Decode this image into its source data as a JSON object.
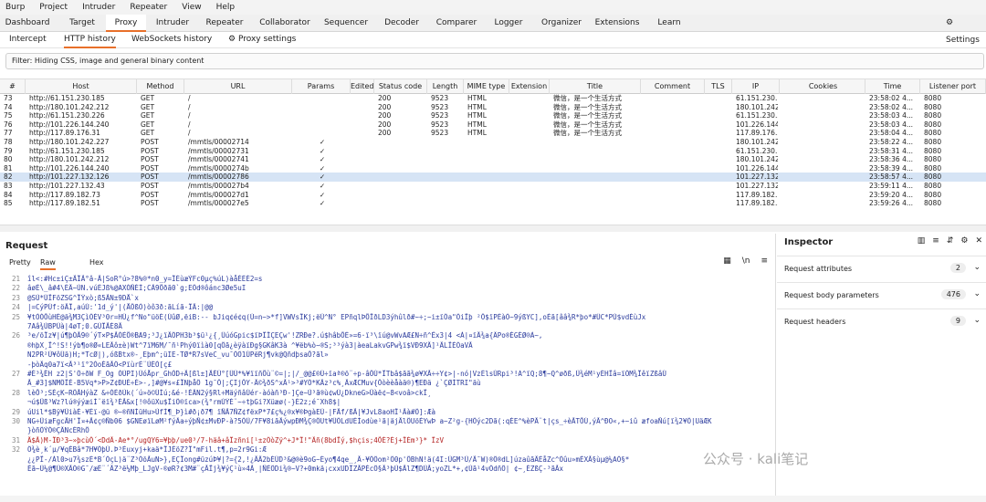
{
  "menubar": {
    "items": [
      "Burp",
      "Project",
      "Intruder",
      "Repeater",
      "View",
      "Help"
    ]
  },
  "main_tabs": {
    "items": [
      {
        "label": "Dashboard"
      },
      {
        "label": "Target"
      },
      {
        "label": "Proxy"
      },
      {
        "label": "Intruder"
      },
      {
        "label": "Repeater"
      },
      {
        "label": "Collaborator"
      },
      {
        "label": "Sequencer"
      },
      {
        "label": "Decoder"
      },
      {
        "label": "Comparer"
      },
      {
        "label": "Logger"
      },
      {
        "label": "Organizer"
      },
      {
        "label": "Extensions"
      },
      {
        "label": "Learn"
      }
    ],
    "active": "Proxy",
    "settings_label": "Settings",
    "settings_icon": "gear-icon"
  },
  "proxy_tabs": {
    "items": [
      {
        "label": "Intercept"
      },
      {
        "label": "HTTP history"
      },
      {
        "label": "WebSockets history"
      }
    ],
    "active": "HTTP history",
    "settings_label": "Proxy settings"
  },
  "filter": {
    "text": "Filter: Hiding CSS, image and general binary content"
  },
  "history_table": {
    "columns": [
      "#",
      "Host",
      "Method",
      "URL",
      "Params",
      "Edited",
      "Status code",
      "Length",
      "MIME type",
      "Extension",
      "Title",
      "Comment",
      "TLS",
      "IP",
      "Cookies",
      "Time",
      "Listener port"
    ],
    "rows": [
      {
        "id": "73",
        "host": "http://61.151.230.185",
        "method": "GET",
        "url": "/",
        "params": "",
        "status": "200",
        "length": "9523",
        "mime": "HTML",
        "title": "微信，是一个生活方式",
        "ip": "61.151.230.185",
        "time": "23:58:02 4...",
        "port": "8080"
      },
      {
        "id": "74",
        "host": "http://180.101.242.212",
        "method": "GET",
        "url": "/",
        "params": "",
        "status": "200",
        "length": "9523",
        "mime": "HTML",
        "title": "微信，是一个生活方式",
        "ip": "180.101.242.212",
        "time": "23:58:02 4...",
        "port": "8080"
      },
      {
        "id": "75",
        "host": "http://61.151.230.226",
        "method": "GET",
        "url": "/",
        "params": "",
        "status": "200",
        "length": "9523",
        "mime": "HTML",
        "title": "微信，是一个生活方式",
        "ip": "61.151.230.226",
        "time": "23:58:03 4...",
        "port": "8080"
      },
      {
        "id": "76",
        "host": "http://101.226.144.240",
        "method": "GET",
        "url": "/",
        "params": "",
        "status": "200",
        "length": "9523",
        "mime": "HTML",
        "title": "微信，是一个生活方式",
        "ip": "101.226.144.240",
        "time": "23:58:03 4...",
        "port": "8080"
      },
      {
        "id": "77",
        "host": "http://117.89.176.31",
        "method": "GET",
        "url": "/",
        "params": "",
        "status": "200",
        "length": "9523",
        "mime": "HTML",
        "title": "微信，是一个生活方式",
        "ip": "117.89.176.31",
        "time": "23:58:04 4...",
        "port": "8080"
      },
      {
        "id": "78",
        "host": "http://180.101.242.227",
        "method": "POST",
        "url": "/mmtls/00002714",
        "params": "✓",
        "status": "",
        "length": "",
        "mime": "",
        "title": "",
        "ip": "180.101.242.227",
        "time": "23:58:22 4...",
        "port": "8080"
      },
      {
        "id": "79",
        "host": "http://61.151.230.185",
        "method": "POST",
        "url": "/mmtls/00002731",
        "params": "✓",
        "status": "",
        "length": "",
        "mime": "",
        "title": "",
        "ip": "61.151.230.185",
        "time": "23:58:31 4...",
        "port": "8080"
      },
      {
        "id": "80",
        "host": "http://180.101.242.212",
        "method": "POST",
        "url": "/mmtls/00002741",
        "params": "✓",
        "status": "",
        "length": "",
        "mime": "",
        "title": "",
        "ip": "180.101.242.212",
        "time": "23:58:36 4...",
        "port": "8080"
      },
      {
        "id": "81",
        "host": "http://101.226.144.240",
        "method": "POST",
        "url": "/mmtls/0000274b",
        "params": "✓",
        "status": "",
        "length": "",
        "mime": "",
        "title": "",
        "ip": "101.226.144.240",
        "time": "23:58:39 4...",
        "port": "8080"
      },
      {
        "id": "82",
        "host": "http://101.227.132.126",
        "method": "POST",
        "url": "/mmtls/00002786",
        "params": "✓",
        "status": "",
        "length": "",
        "mime": "",
        "title": "",
        "ip": "101.227.132.126",
        "time": "23:58:57 4...",
        "port": "8080",
        "selected": true
      },
      {
        "id": "83",
        "host": "http://101.227.132.43",
        "method": "POST",
        "url": "/mmtls/000027b4",
        "params": "✓",
        "status": "",
        "length": "",
        "mime": "",
        "title": "",
        "ip": "101.227.132.43",
        "time": "23:59:11 4...",
        "port": "8080"
      },
      {
        "id": "84",
        "host": "http://117.89.182.73",
        "method": "POST",
        "url": "/mmtls/000027d1",
        "params": "✓",
        "status": "",
        "length": "",
        "mime": "",
        "title": "",
        "ip": "117.89.182.73",
        "time": "23:59:20 4...",
        "port": "8080"
      },
      {
        "id": "85",
        "host": "http://117.89.182.51",
        "method": "POST",
        "url": "/mmtls/000027e5",
        "params": "✓",
        "status": "",
        "length": "",
        "mime": "",
        "title": "",
        "ip": "117.89.182.51",
        "time": "23:59:26 4...",
        "port": "8080"
      }
    ]
  },
  "request": {
    "title": "Request",
    "tabs": [
      "Pretty",
      "Raw",
      "Hex"
    ],
    "active_tab": "Raw",
    "lines": [
      {
        "n": "21",
        "t": "îl<:#Hc±iÇ±ÃÏÃ°â-Ã|SoR°ú>?8%®*n0_y=ÏÈùæÝFc0µç%úL)àåÉÉÉ2=s"
      },
      {
        "n": "22",
        "t": "âøÉ\\_â#4\\ÉÄ~ÚN.vúÉJß%@AXÒÑÉÍ;CÂ9Õðã0`g;EÖd®ôánc3Øe5uI"
      },
      {
        "n": "23",
        "t": "@SÙ*ÜÏFöZSG^ÏÝxò;ß5ÃN±9DÅ`x"
      },
      {
        "n": "24",
        "t": "|=CýPÚf:öÄÏ,aúÙ:'1d_ý'|(ÅÔßÒ)òô3ð:ãLíã-ÏÃ:|@@"
      },
      {
        "n": "25",
        "t": "¥tÒÒÕùHÉ@ä¾M3ÇìÖÉV³0r=HÜ¿f^No\"üöÉ(ÙûØ,ëiB:-- bJiq¢é¢q(Ú=n~>*f]VWVsÏKj;ëÜ^N° EPñqlÞÕÏðLD3ýhûlð#~÷;~i±ïÖa\"ÖiÏþ ²Ô$ïPÉàÒ~9ýßYC],oÉã[ââ¾R*þo*#ÜC*PÚ$vdÈùJx"
      },
      {
        "n": "",
        "t": "7Aâ¾ÙBPÜà|4øT;0.GÙÏÃÉ8Ã"
      },
      {
        "n": "26",
        "t": "³e/õÏz¥|ú¶þÓÃ9®´ýT×P$ÃÒÈÕ®BA9;³J¿ïÃÖPH3b³$ü¹¿{¸ÜúóGpic$ïÞÏÎÇEÇw'!ZRÐe?.ú$hâbÕÈ»=6·ï³\\ïú@vWvAÆ£N÷ñ^Êx3|4 <Á|¤ïÄ¾a{ÂPo®ÉGÉØ®À~,"
      },
      {
        "n": "",
        "t": "®hþX¸Ï^!S!!ýb¶o®Ø«LEÃô±è)Wt^7ïM6M/¯ñ¹Phý0ïìà0[qÔã¿èÿàïÐg§GKâK3à ^¥ëb%ò~®S;³³ýà3|àeaLakvGPw¾ï$VÐ9XÄ]¹ÄLÏÉÒaVÃ"
      },
      {
        "n": "",
        "t": "N2PR²Ü¥ôÜä)H;*TcØ|),óßBtx®-¸Eþm^;üIE-TØ*R7sVeC_vu¯ÖÖ1ÚPëRj¶vk@QñdþsaÕ?ãl»"
      },
      {
        "n": "",
        "t": "-þòÃq0a7ï<Ã³¹ï°2ÒoÉãÃÖ<PïùrÉ¨ÚÉÓ[ç£"
      },
      {
        "n": "27",
        "t": "#É³¾ÊH z2|S'Ö÷ðW F_Og ÒÙPI)ÜóÅpr_GhÒD÷Ã[ßl±]ÃÈÜ°[ÜÙ*%¥ïïñÕù¨©=|;|/_@@£®Ù÷ïaª®õ¨÷p-âÔÙ*ÏTbâ$ãã¾ø¥XÃ÷÷Y¢>|-nó|VzÉlsÚRpi³!A^ïQ;8¶~Q^øðß,Ü¾éM¹yÉHÏâ=ïÖM¾ÏêïZßâÙ"
      },
      {
        "n": "",
        "t": "Ã_#3]$NMÖÏÉ-B5Vq*>P>Z¢ÐUÉ÷É>-,]#@¥s«£ÏNþåÖ 1g¯Ô|;ÇIjÔY-Ã©¾ðS^xÃ¹>³#YÖ*KÄz³c%¸ÄxÆCMuv{Ôòèèåàä®)¶EÐä ¿`ÇØÍTRI\"äù"
      },
      {
        "n": "28",
        "t": "lèÕ³;SÉçK~RÖÃHýàZ &÷ÒÉðÙk(´ú»ö©ÜÍú;&é-!ÉÂN2ý§Rl÷MäýñâÙér-àóàñ³Ð-]Çe~Ù³ã®ù¢wÙ¿DkneG>Ûàë¢~8<voâ>ckÏ¸"
      },
      {
        "n": "",
        "t": "¬ú$Ûß³Wz?lú®ýýæiÌ¨ëï¾³ÉÃ&x[!®ôüXu$ÏiÖ®ïca>(¾°rmÚÝÉ¨~÷tþGi?Xüæø(-}É2z;é¯Xh8$|"
      },
      {
        "n": "29",
        "t": "úUil*$Bÿ¥ÜiàÉ-¥Éï-@ü ®~®ñNÍüHu>ÙfÍ¶_Þ}ì#ð¡ð7¶ ïÑÃ7ÑZ¢fëxP*7£ç%¿®x¥®ÞgàEÜ-|FÃf/ßÃ|¥JvL8aoHÏ¹Ãà#Ö]:Æà"
      },
      {
        "n": "30",
        "t": "NG÷ÜiæFgcÃH'Ï¤+Ã¢ç®Ñb06 $GNEøïLøM²fýÂa÷ýþÑ¢±MvÐP-à?5ÖÜ/7F¥8iãÃýwpÐM¾Ç®ÖUt¥ÜÖLdUÉÍodùe¹ã|äjÃlÖUöÉYwÞ a~Z²g-{HÖýc2Dã(:qÉE^%èPÃ¨t|çs_÷èÃTÕÚ,ýÃ^ÐO«,+~iû æfoaÑú[ï¾2¥Ö|UäÆK"
      },
      {
        "n": "",
        "t": "}òñÖÝÓ®ÇÂNcÉRhÔ"
      },
      {
        "n": "31",
        "t": "Ä$Ã)M-ÏÐ³3~»þcùÔ´<DdÃ-Ae*°/ugQY6=¥þþ/ue0³/7-häâ+âÏzñni[¹±zÖòZÿ^+J*Ï!\"Äñ(8bdÏý,$hçis;4ÕÉ?Éj+ÏÉm³}* ÏzV",
        "red": true
      },
      {
        "n": "32",
        "t": "Ö¾è¸k´µ/¥qÉBâ*7H¥ÖþÜ.Þ³Éuxyj+kaä*ÏJÉöZ?Ï\"mFil.t¶,p=2r9Gi:Æ"
      },
      {
        "n": "",
        "t": "¿¿PÏ-/Ál0>u7¾szÉ*B´ÖçL)ä¨Z³ÖõÃuN>},EÇÏong#üzúÞ¥|?={2,!¿ÃÄ2bÉÜD³&@®è9oG~Éyo¶4qe_¸Ã-¥ÖÖom²Ö0p'ÔBhN!ä(4I:ÜGM³Ü/Ã¯W)®Ö®dL]úzaûãÄÉåZc^Öûu»mÉXÃ§ùµ@¼AÖ§*"
      },
      {
        "n": "",
        "t": "Éã~Ü¼@¶Ü®XÃÒ®G¯/æÉ¨´ÃZ³ë¼Mþ_LJgV-®øR?¢3M#¨çÃÏj¾¥ýÇ¹ù»4Ã¸|ÑÉÖDi¾®~V?+0mkä¡cxxUDÏZÃPÉcÖ§Ã³þÙ$ÃlZ¶DÜÃ;yoZL*+,¢Ùã¹4vÖdñÖ| ¢~¸ÉZßÇ-³ãÃx"
      }
    ],
    "toolbar_icons": [
      "toggle-icon",
      "wrap-icon",
      "menu-icon"
    ]
  },
  "inspector": {
    "title": "Inspector",
    "rows": [
      {
        "label": "Request attributes",
        "count": "2"
      },
      {
        "label": "Request body parameters",
        "count": "476"
      },
      {
        "label": "Request headers",
        "count": "9"
      }
    ]
  },
  "watermark": {
    "text": "公众号 · kali笔记"
  }
}
